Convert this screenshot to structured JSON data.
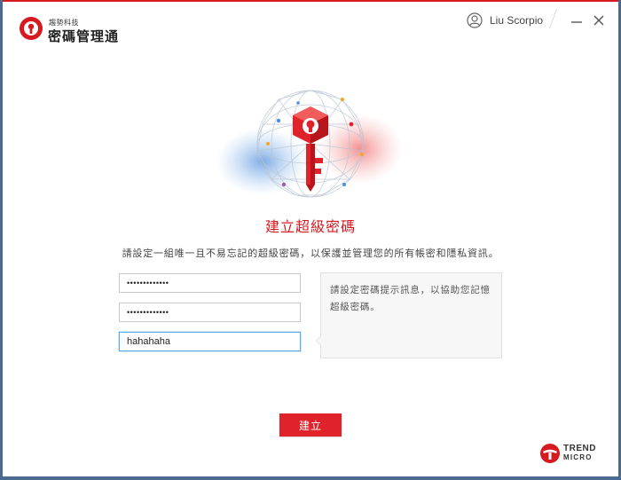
{
  "window": {
    "brand_company": "趨勢科技",
    "brand_product": "密碼管理通",
    "user_name": "Liu Scorpio"
  },
  "icons": {
    "logo": "trend-micro-password-manager-logo-icon",
    "user": "user-icon",
    "minimize": "minimize-icon",
    "close": "close-icon",
    "hero": "red-key-sphere-illustration"
  },
  "main": {
    "title": "建立超級密碼",
    "subtitle": "請設定一組唯一且不易忘記的超級密碼，以保護並管理您的所有帳密和隱私資訊。",
    "password_masked": "•••••••••••••",
    "confirm_masked": "•••••••••••••",
    "hint_value": "hahahaha",
    "hint_help": "請設定密碼提示訊息，以協助您記憶超級密碼。",
    "create_label": "建立"
  },
  "footer": {
    "brand_line1": "TREND",
    "brand_line2": "MICRO"
  },
  "colors": {
    "accent": "#d71920",
    "button": "#e0232b",
    "focus_border": "#5aa9e6"
  }
}
